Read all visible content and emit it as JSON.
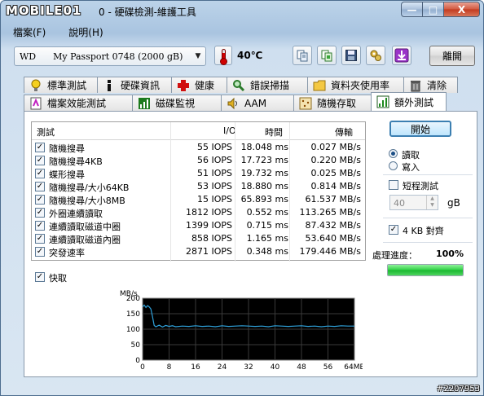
{
  "window": {
    "logo_text": "MOBILE01",
    "title": "0 - 硬碟檢測-維護工具",
    "buttons": {
      "minimize": "—",
      "maximize": "□",
      "close": "X"
    }
  },
  "menu": {
    "file": "檔案(F)",
    "help": "說明(H)"
  },
  "toolbar": {
    "drive": "WD      My Passport 0748 (2000 gB)",
    "temperature": "40℃",
    "exit_label": "離開",
    "icons": [
      "copy-icon",
      "copy-green-icon",
      "save-icon",
      "tools-icon",
      "download-icon"
    ]
  },
  "tabs_row1": [
    {
      "label": "標準測試",
      "icon": "lightbulb-icon"
    },
    {
      "label": "硬碟資訊",
      "icon": "info-icon"
    },
    {
      "label": "健康",
      "icon": "health-cross-icon"
    },
    {
      "label": "錯誤掃描",
      "icon": "scan-icon"
    },
    {
      "label": "資料夾使用率",
      "icon": "folder-icon"
    },
    {
      "label": "清除",
      "icon": "trash-icon"
    }
  ],
  "tabs_row2": [
    {
      "label": "檔案效能測試",
      "icon": "file-bench-icon"
    },
    {
      "label": "磁碟監視",
      "icon": "monitor-icon"
    },
    {
      "label": "AAM",
      "icon": "speaker-icon"
    },
    {
      "label": "隨機存取",
      "icon": "random-icon"
    },
    {
      "label": "額外測試",
      "icon": "extra-icon",
      "active": true
    }
  ],
  "results": {
    "headers": {
      "test": "測試",
      "io": "I/O",
      "time": "時間",
      "transfer": "傳輸"
    },
    "rows": [
      {
        "checked": true,
        "name": "隨機搜尋",
        "io": "55 IOPS",
        "time": "18.048 ms",
        "transfer": "0.027 MB/s"
      },
      {
        "checked": true,
        "name": "隨機搜尋4KB",
        "io": "56 IOPS",
        "time": "17.723 ms",
        "transfer": "0.220 MB/s"
      },
      {
        "checked": true,
        "name": "蝶形搜尋",
        "io": "51 IOPS",
        "time": "19.732 ms",
        "transfer": "0.025 MB/s"
      },
      {
        "checked": true,
        "name": "隨機搜尋/大小64KB",
        "io": "53 IOPS",
        "time": "18.880 ms",
        "transfer": "0.814 MB/s"
      },
      {
        "checked": true,
        "name": "隨機搜尋/大小8MB",
        "io": "15 IOPS",
        "time": "65.893 ms",
        "transfer": "61.537 MB/s"
      },
      {
        "checked": true,
        "name": "外圈連續讀取",
        "io": "1812 IOPS",
        "time": "0.552 ms",
        "transfer": "113.265 MB/s"
      },
      {
        "checked": true,
        "name": "連續讀取磁道中圈",
        "io": "1399 IOPS",
        "time": "0.715 ms",
        "transfer": "87.432 MB/s"
      },
      {
        "checked": true,
        "name": "連續讀取磁道內圈",
        "io": "858 IOPS",
        "time": "1.165 ms",
        "transfer": "53.640 MB/s"
      },
      {
        "checked": true,
        "name": "突發速率",
        "io": "2871 IOPS",
        "time": "0.348 ms",
        "transfer": "179.446 MB/s"
      }
    ]
  },
  "controls": {
    "start_label": "開始",
    "read_label": "讀取",
    "write_label": "寫入",
    "read_selected": true,
    "short_test_label": "短程測試",
    "short_test_checked": false,
    "size_value": "40",
    "size_unit": "gB",
    "align_label": "4 KB 對齊",
    "align_checked": true,
    "progress_label": "處理進度：",
    "progress_value": "100%",
    "progress_fraction": 1.0,
    "quick_label": "快取",
    "quick_checked": true
  },
  "chart_data": {
    "type": "line",
    "ylabel": "MB/s",
    "xlabel": "",
    "xlim": [
      0,
      64
    ],
    "ylim": [
      0,
      200
    ],
    "yticks": [
      "200",
      "150",
      "100",
      "50",
      "0"
    ],
    "xticks": [
      "0",
      "8",
      "16",
      "24",
      "32",
      "40",
      "48",
      "56",
      "64MB"
    ],
    "series": [
      {
        "color": "#2fa0d8",
        "x": [
          0,
          0.5,
          1,
          1.5,
          2,
          2.5,
          3,
          3.5,
          4,
          5,
          6,
          7,
          8,
          9,
          10,
          12,
          14,
          16,
          18,
          20,
          22,
          24,
          26,
          28,
          30,
          32,
          34,
          36,
          38,
          40,
          42,
          44,
          46,
          48,
          50,
          52,
          54,
          56,
          58,
          60,
          62,
          64
        ],
        "y": [
          172,
          178,
          170,
          176,
          172,
          165,
          140,
          112,
          108,
          113,
          107,
          112,
          109,
          111,
          108,
          110,
          109,
          111,
          109,
          110,
          108,
          111,
          109,
          110,
          111,
          110,
          109,
          110,
          108,
          111,
          110,
          109,
          110,
          111,
          109,
          110,
          108,
          110,
          109,
          111,
          110,
          110
        ]
      }
    ],
    "grid": true,
    "background": "#000000"
  },
  "footer": {
    "id": "#2207953"
  }
}
